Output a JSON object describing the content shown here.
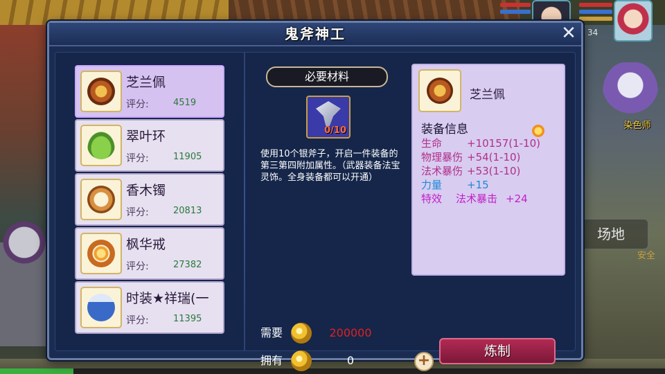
{
  "hud": {
    "level": "34",
    "npc_name": "染色师",
    "side_button": "场地",
    "side_button_sub": "安全",
    "exp_fill": 0.11
  },
  "dialog": {
    "title": "鬼斧神工",
    "close_label": "✕"
  },
  "equipment_list": [
    {
      "name": "芝兰佩",
      "score_label": "评分:",
      "score": "4519",
      "icon": "pendant-icon",
      "selected": true
    },
    {
      "name": "翠叶环",
      "score_label": "评分:",
      "score": "11905",
      "icon": "leaf-icon",
      "selected": false
    },
    {
      "name": "香木镯",
      "score_label": "评分:",
      "score": "20813",
      "icon": "bracelet-icon",
      "selected": false
    },
    {
      "name": "枫华戒",
      "score_label": "评分:",
      "score": "27382",
      "icon": "ring-icon",
      "selected": false
    },
    {
      "name": "时装★祥瑞(一",
      "score_label": "评分:",
      "score": "11395",
      "icon": "fashion-icon",
      "selected": false
    }
  ],
  "materials": {
    "header": "必要材料",
    "item_icon": "silver-axe-icon",
    "count": "0/10",
    "description": "使用10个银斧子，开启一件装备的第三第四附加属性。（武器装备法宝灵饰。全身装备都可以开通）"
  },
  "detail": {
    "name": "芝兰佩",
    "section": "装备信息",
    "stats": [
      {
        "key": "生命",
        "value": "+10157(1-10)",
        "key_color": "#b0308a",
        "value_color": "#b0308a"
      },
      {
        "key": "物理暴伤",
        "value": "+54(1-10)",
        "key_color": "#b0308a",
        "value_color": "#b0308a"
      },
      {
        "key": "法术暴伤",
        "value": "+53(1-10)",
        "key_color": "#b0308a",
        "value_color": "#b0308a"
      },
      {
        "key": "力量",
        "value": "+15",
        "key_color": "#1a8ad8",
        "value_color": "#1a8ad8"
      },
      {
        "key": "特效",
        "value": "法术暴击",
        "extra": "+24",
        "key_color": "#c020c8",
        "value_color": "#c020c8"
      }
    ]
  },
  "cost": {
    "need_label": "需要",
    "need_value": "200000",
    "need_color": "#e02020",
    "have_label": "拥有",
    "have_value": "0",
    "add_label": "+",
    "craft_label": "炼制"
  }
}
